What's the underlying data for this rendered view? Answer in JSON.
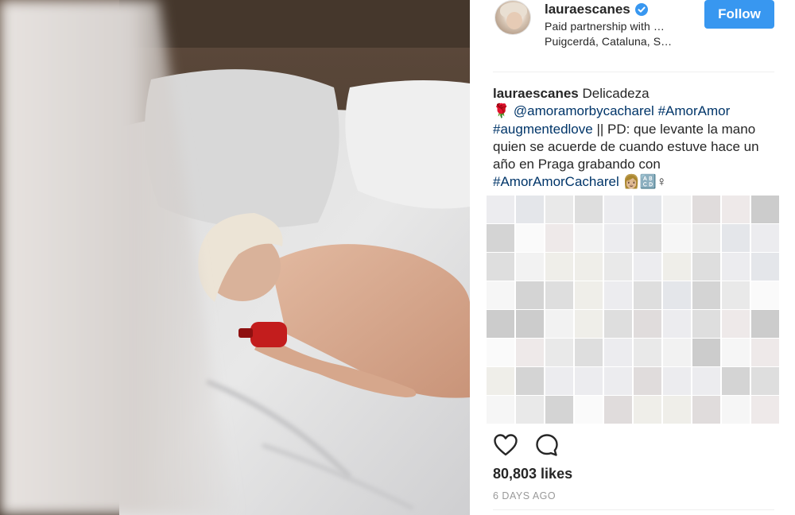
{
  "post": {
    "image_alt": "Photo of a person lying on a bed holding a red perfume bottle",
    "header": {
      "username": "lauraescanes",
      "verified": true,
      "partnership": "Paid partnership with …",
      "location": "Puigcerdá, Cataluna, S…",
      "follow_label": "Follow"
    },
    "caption": {
      "author": "lauraescanes",
      "first_line": " Delicadeza",
      "rose_emoji": "🌹",
      "mention": "@amoramorbycacharel",
      "hashtag1": "#AmorAmor",
      "hashtag2": "#augmentedlove",
      "text": " || PD: que levante la mano quien se acuerde de cuando estuve hace un año en Praga grabando con ",
      "hashtag3": "#AmorAmorCacharel",
      "end_emojis": " 👩🏼🔠♀"
    },
    "actions": {
      "like_icon": "heart-outline-icon",
      "comment_icon": "comment-bubble-icon"
    },
    "likes": "80,803 likes",
    "time": "6 DAYS AGO"
  },
  "colors": {
    "follow_button": "#3897f0",
    "link": "#003569",
    "verified_badge": "#3897f0",
    "text": "#262626",
    "muted": "#999999"
  }
}
